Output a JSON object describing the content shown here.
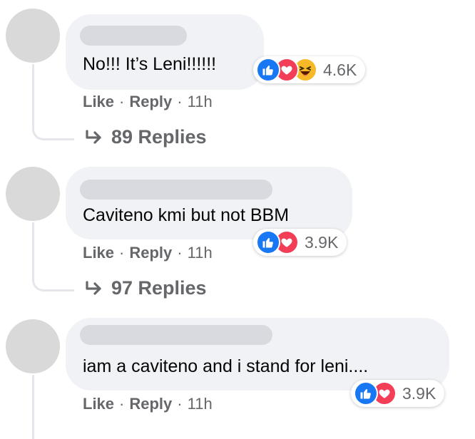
{
  "comments": [
    {
      "text": "No!!! It’s Leni!!!!!!",
      "reactions": [
        "like-icon",
        "love-icon",
        "haha-icon"
      ],
      "reaction_count": "4.6K",
      "like_label": "Like",
      "reply_label": "Reply",
      "time": "11h",
      "replies_label": "89 Replies"
    },
    {
      "text": "Caviteno kmi but not BBM",
      "reactions": [
        "like-icon",
        "love-icon"
      ],
      "reaction_count": "3.9K",
      "like_label": "Like",
      "reply_label": "Reply",
      "time": "11h",
      "replies_label": "97 Replies"
    },
    {
      "text": "iam a caviteno and i stand for leni....",
      "reactions": [
        "like-icon",
        "love-icon"
      ],
      "reaction_count": "3.9K",
      "like_label": "Like",
      "reply_label": "Reply",
      "time": "11h"
    }
  ],
  "separator": "·",
  "colors": {
    "bubble": "#f0f2f5",
    "like": "#1877f2",
    "love": "#f33e58",
    "haha": "#f7b928",
    "meta_text": "#65676b"
  }
}
